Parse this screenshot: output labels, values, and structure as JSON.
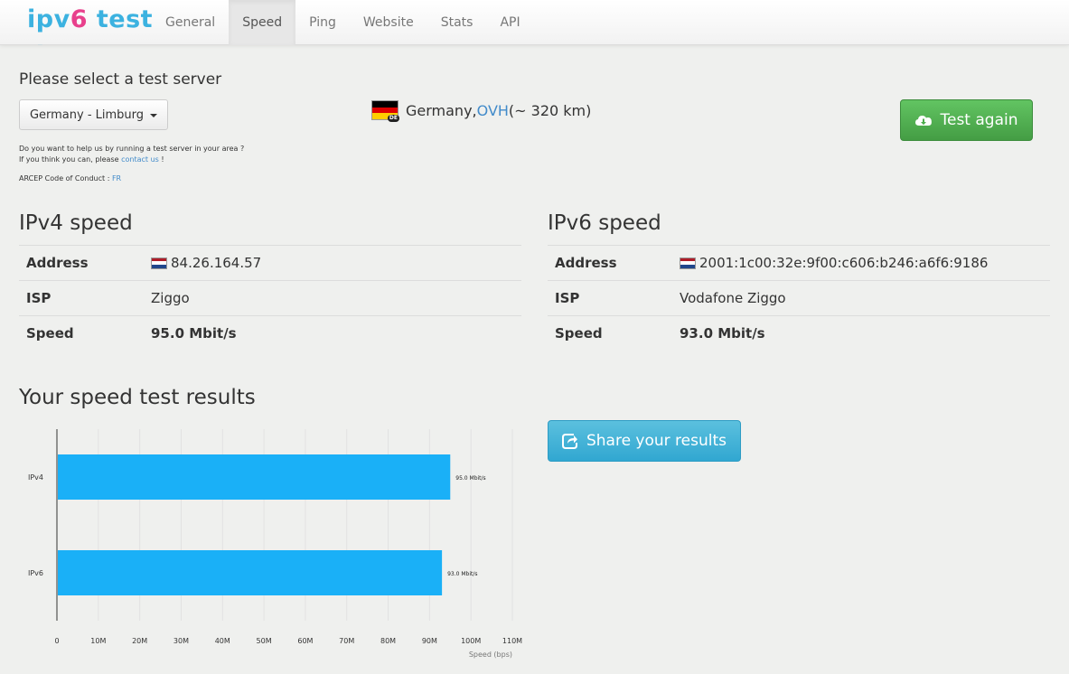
{
  "brand": {
    "part1": "ipv",
    "part2": "6",
    "part3": " test"
  },
  "nav": [
    {
      "label": "General",
      "active": false
    },
    {
      "label": "Speed",
      "active": true
    },
    {
      "label": "Ping",
      "active": false
    },
    {
      "label": "Website",
      "active": false
    },
    {
      "label": "Stats",
      "active": false
    },
    {
      "label": "API",
      "active": false
    }
  ],
  "server": {
    "heading": "Please select a test server",
    "selected": "Germany - Limburg",
    "help_line1": "Do you want to help us by running a test server in your area ?",
    "help_line2_prefix": "If you think you can, please ",
    "help_link": "contact us",
    "help_line2_suffix": " !",
    "arcep_prefix": "ARCEP Code of Conduct : ",
    "arcep_link": "FR",
    "country": "Germany, ",
    "host_link": "OVH",
    "distance": " (~ 320 km)",
    "flag_badge": "DE",
    "flag_colors": [
      "#000000",
      "#dd0000",
      "#ffce00"
    ]
  },
  "buttons": {
    "test_again": "Test again",
    "share": "Share your results"
  },
  "ipv4": {
    "title": "IPv4 speed",
    "address_label": "Address",
    "address": "84.26.164.57",
    "isp_label": "ISP",
    "isp": "Ziggo",
    "speed_label": "Speed",
    "speed": "95.0 Mbit/s"
  },
  "ipv6": {
    "title": "IPv6 speed",
    "address_label": "Address",
    "address": "2001:1c00:32e:9f00:c606:b246:a6f6:9186",
    "isp_label": "ISP",
    "isp": "Vodafone Ziggo",
    "speed_label": "Speed",
    "speed": "93.0 Mbit/s"
  },
  "results": {
    "title": "Your speed test results"
  },
  "chart_data": {
    "type": "bar",
    "orientation": "horizontal",
    "categories": [
      "IPv4",
      "IPv6"
    ],
    "values": [
      95.0,
      93.0
    ],
    "unit_multiplier": 1000000,
    "data_labels": [
      "95.0 Mbit/s",
      "93.0 Mbit/s"
    ],
    "xlim": [
      0,
      110
    ],
    "ticks": [
      0,
      10,
      20,
      30,
      40,
      50,
      60,
      70,
      80,
      90,
      100,
      110
    ],
    "tick_labels": [
      "0",
      "10M",
      "20M",
      "30M",
      "40M",
      "50M",
      "60M",
      "70M",
      "80M",
      "90M",
      "100M",
      "110M"
    ],
    "xlabel": "Speed (bps)",
    "grid": true,
    "bar_color": "#1ab0f7"
  }
}
